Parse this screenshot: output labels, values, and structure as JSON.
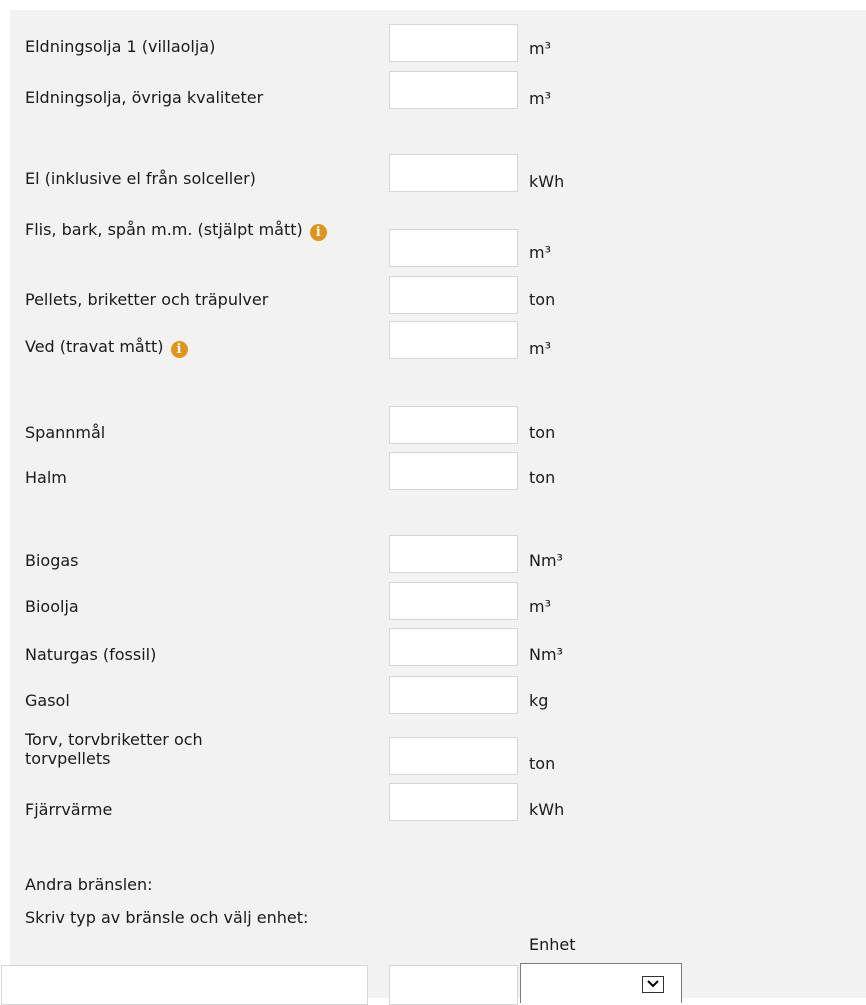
{
  "fuels": [
    {
      "label": "Eldningsolja 1 (villaolja)",
      "unit": "m³"
    },
    {
      "label": "Eldningsolja, övriga kvaliteter",
      "unit": "m³"
    },
    {
      "label": "El (inklusive el från solceller)",
      "unit": "kWh"
    },
    {
      "label": "Flis, bark, spån m.m. (stjälpt mått)",
      "unit": "m³"
    },
    {
      "label": "Pellets, briketter och träpulver",
      "unit": "ton"
    },
    {
      "label": "Ved (travat mått)",
      "unit": "m³"
    },
    {
      "label": "Spannmål",
      "unit": "ton"
    },
    {
      "label": "Halm",
      "unit": "ton"
    },
    {
      "label": "Biogas",
      "unit": "Nm³"
    },
    {
      "label": "Bioolja",
      "unit": "m³"
    },
    {
      "label": "Naturgas (fossil)",
      "unit": "Nm³"
    },
    {
      "label": "Gasol",
      "unit": "kg"
    },
    {
      "label": "Torv, torvbriketter och torvpellets",
      "unit": "ton"
    },
    {
      "label": "Fjärrvärme",
      "unit": "kWh"
    }
  ],
  "other_fuels": {
    "heading": "Andra bränslen:",
    "instruction": "Skriv typ av bränsle och välj enhet:",
    "unit_header": "Enhet",
    "selected_unit": ""
  },
  "info_icon": {
    "glyph": "i",
    "color": "#e0951a"
  }
}
